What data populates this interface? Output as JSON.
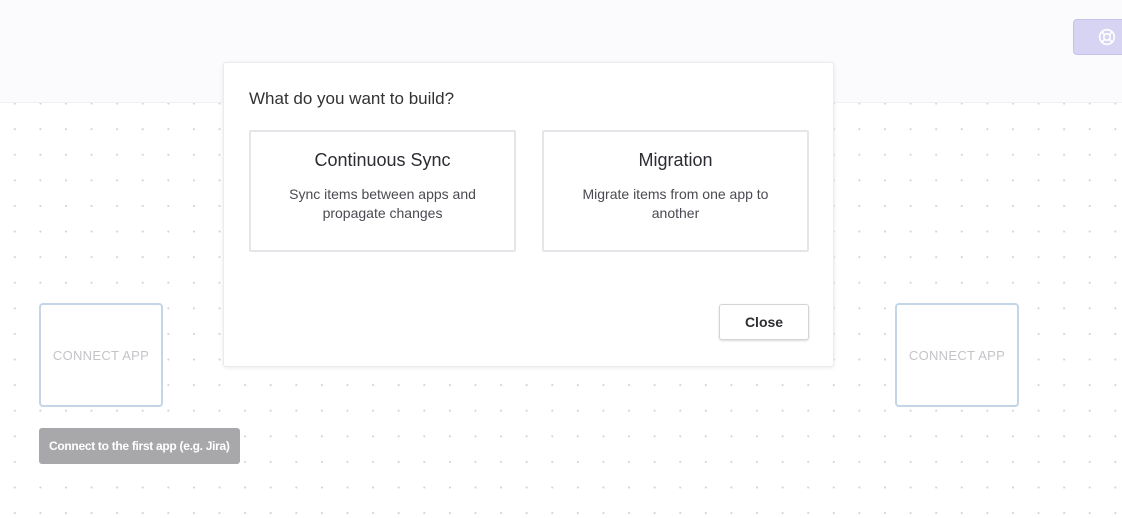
{
  "topbar": {
    "action_icon": "lifebuoy-icon",
    "action_label": ""
  },
  "dialog": {
    "title": "What do you want to build?",
    "options": [
      {
        "title": "Continuous Sync",
        "description": "Sync items between apps and propagate changes"
      },
      {
        "title": "Migration",
        "description": "Migrate items from one app to another"
      }
    ],
    "close_label": "Close"
  },
  "canvas": {
    "left_node_label": "CONNECT APP",
    "right_node_label": "CONNECT APP",
    "hint": "Connect to the first app (e.g. Jira)"
  },
  "colors": {
    "accent": "#d7d4f3",
    "node_border": "#c5d5e8",
    "tooltip_bg": "#a8a8aa"
  }
}
